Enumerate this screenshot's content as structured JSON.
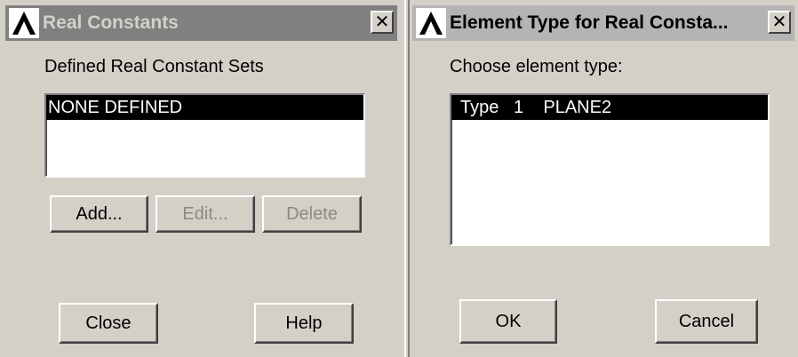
{
  "real_constants": {
    "title": "Real Constants",
    "close_glyph": "✕",
    "sets_label": "Defined Real Constant Sets",
    "list_items": [
      "NONE DEFINED"
    ],
    "add_label": "Add...",
    "edit_label": "Edit...",
    "delete_label": "Delete",
    "close_label": "Close",
    "help_label": "Help"
  },
  "element_type": {
    "title": "Element Type for Real Consta...",
    "close_glyph": "✕",
    "choose_label": "Choose element type:",
    "list_items": [
      "Type   1    PLANE2"
    ],
    "ok_label": "OK",
    "cancel_label": "Cancel"
  },
  "icons": {
    "app_logo": "ansys-lambda-logo-icon",
    "close": "close-x-icon"
  }
}
